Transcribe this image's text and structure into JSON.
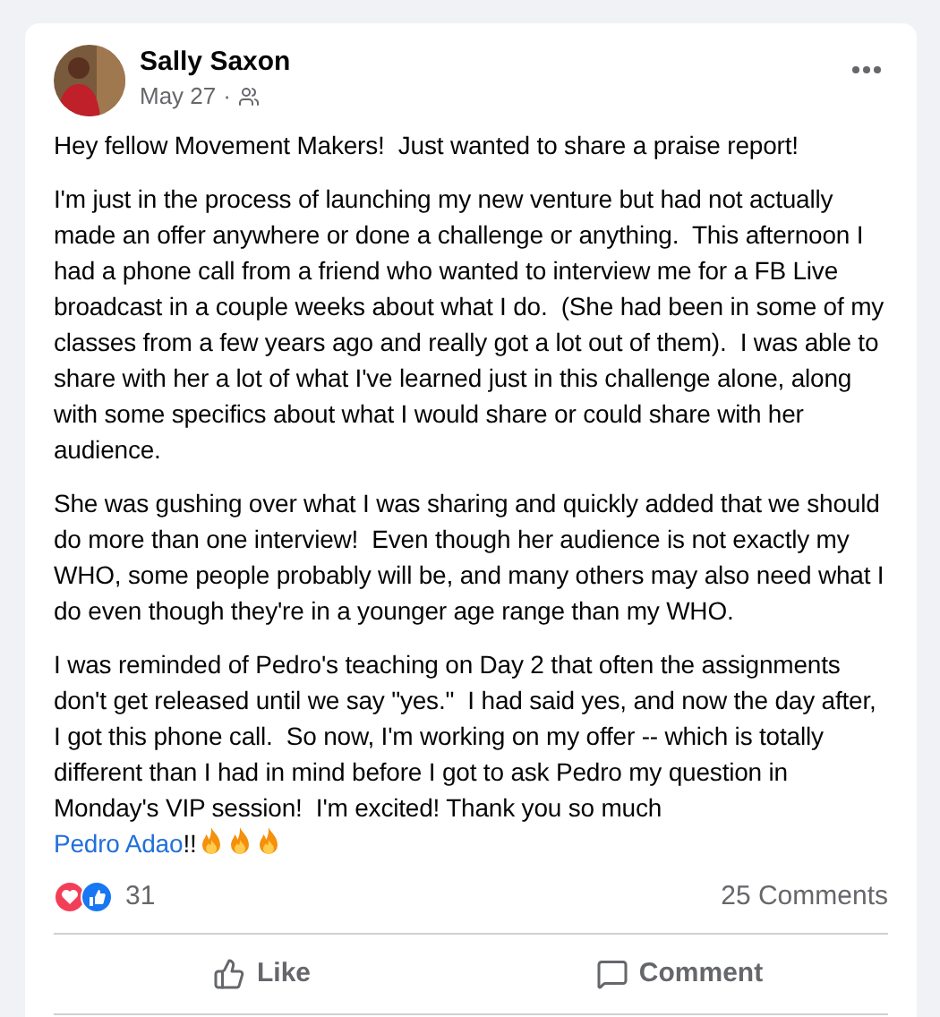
{
  "post": {
    "author": "Sally Saxon",
    "date": "May 27",
    "separator": "·",
    "paragraphs": [
      "Hey fellow Movement Makers!  Just wanted to share a praise report!",
      "I'm just in the process of launching my new venture but had not actually made an offer anywhere or done a challenge or anything.  This afternoon I had a phone call from a friend who wanted to interview me for a FB Live broadcast in a couple weeks about what I do.  (She had been in some of my classes from a few years ago and really got a lot out of them).  I was able to share with her a lot of what I've learned just in this challenge alone, along with some specifics about what I would share or could share with her audience.",
      "She was gushing over what I was sharing and quickly added that we should do more than one interview!  Even though her audience is not exactly my WHO, some people probably will be, and many others may also need what I do even though they're in a younger age range than my WHO."
    ],
    "last_paragraph": {
      "before": "I was reminded of Pedro's teaching on Day 2 that often the assignments don't get released until we say \"yes.\"  I had said yes, and now the day after, I got this phone call.  So now, I'm working on my offer -- which is totally different than I had in mind before I got to ask Pedro my question in Monday's VIP session!  I'm excited! Thank you so much ",
      "link": "Pedro Adao",
      "after": "!!"
    },
    "reaction_count": "31",
    "comments": "25 Comments",
    "actions": [
      {
        "kind": "like",
        "label": "Like"
      },
      {
        "kind": "comment",
        "label": "Comment"
      }
    ]
  }
}
